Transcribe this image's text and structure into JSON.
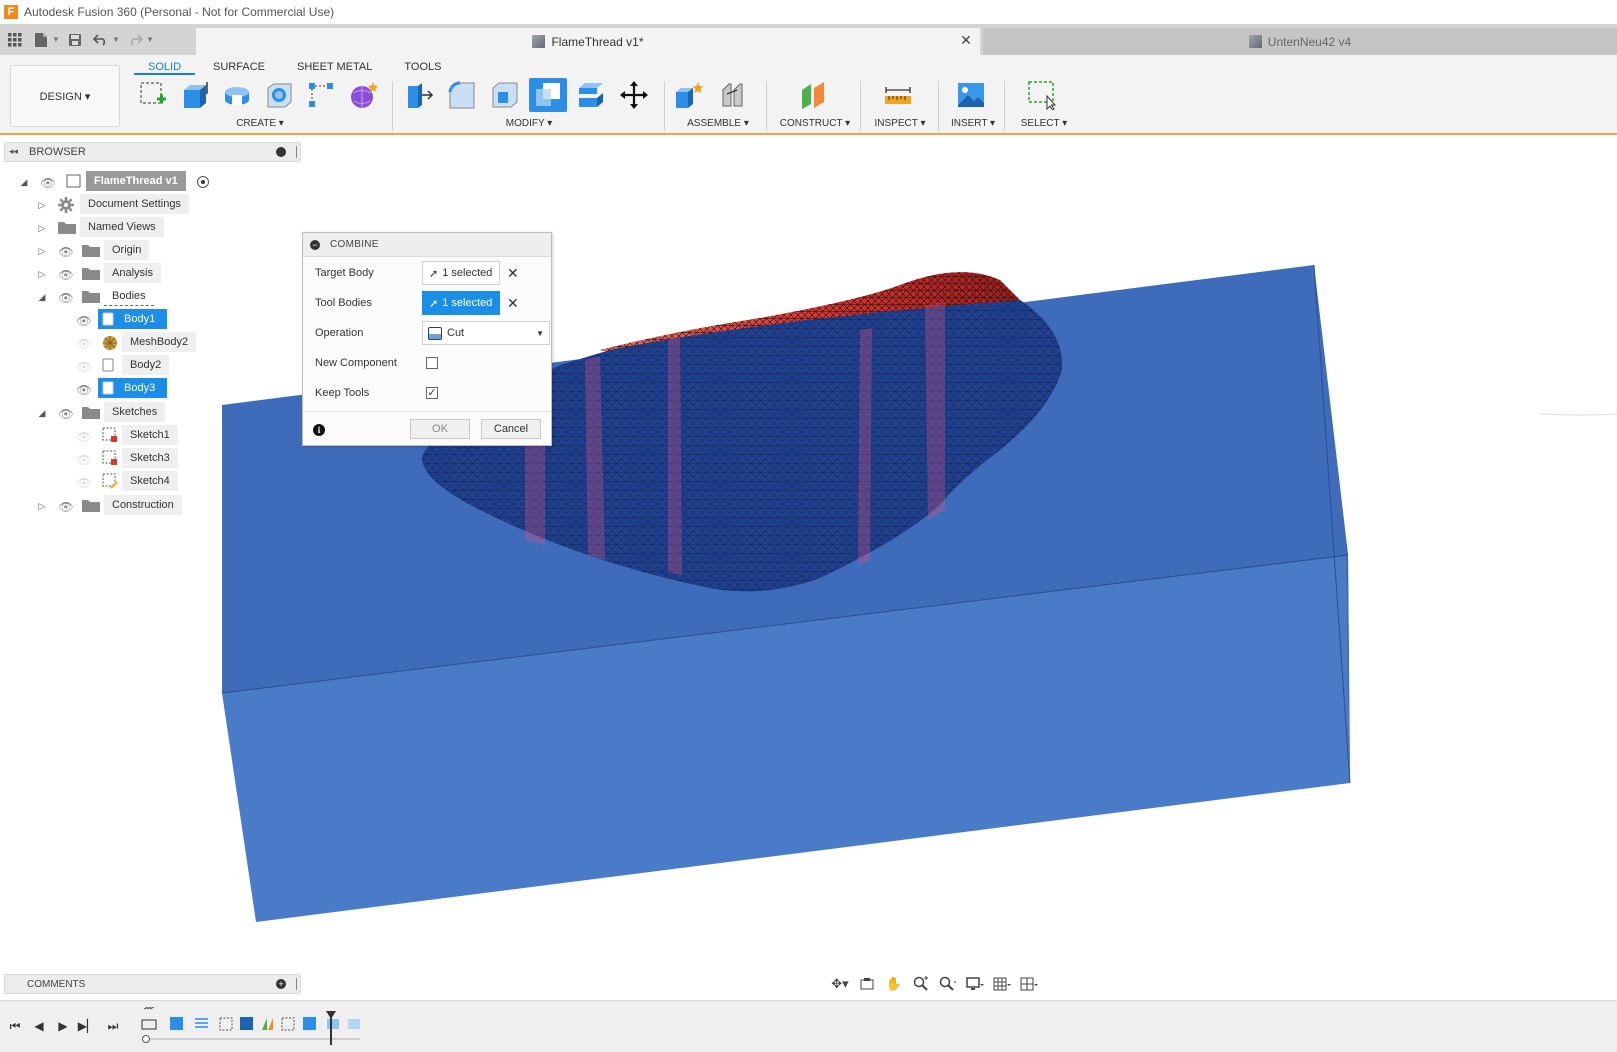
{
  "titlebar": {
    "logo": "F",
    "title": "Autodesk Fusion 360 (Personal - Not for Commercial Use)"
  },
  "documents": {
    "active_tab": "FlameThread v1*",
    "inactive_tab": "UntenNeu42 v4"
  },
  "toolbar": {
    "workspace_label": "DESIGN ▾",
    "tabs": [
      "SOLID",
      "SURFACE",
      "SHEET METAL",
      "TOOLS"
    ],
    "groups": {
      "create": "CREATE ▾",
      "modify": "MODIFY ▾",
      "assemble": "ASSEMBLE ▾",
      "construct": "CONSTRUCT ▾",
      "inspect": "INSPECT ▾",
      "insert": "INSERT ▾",
      "select": "SELECT ▾"
    }
  },
  "browser": {
    "title": "BROWSER",
    "root": "FlameThread v1",
    "items": {
      "document_settings": "Document Settings",
      "named_views": "Named Views",
      "origin": "Origin",
      "analysis": "Analysis",
      "bodies": "Bodies",
      "body1": "Body1",
      "meshbody2": "MeshBody2",
      "body2": "Body2",
      "body3": "Body3",
      "sketches": "Sketches",
      "sketch1": "Sketch1",
      "sketch3": "Sketch3",
      "sketch4": "Sketch4",
      "construction": "Construction"
    }
  },
  "combine_dialog": {
    "title": "COMBINE",
    "target_body_label": "Target Body",
    "target_body_value": "1 selected",
    "tool_bodies_label": "Tool Bodies",
    "tool_bodies_value": "1 selected",
    "operation_label": "Operation",
    "operation_value": "Cut",
    "new_component_label": "New Component",
    "new_component_checked": false,
    "keep_tools_label": "Keep Tools",
    "keep_tools_checked": true,
    "ok_label": "OK",
    "cancel_label": "Cancel"
  },
  "comments": {
    "title": "COMMENTS"
  },
  "colors": {
    "accent": "#1b8ee8",
    "toolbar_border": "#f5a442",
    "box_blue": "#4a7bc8",
    "mesh_red": "#e0413d"
  }
}
